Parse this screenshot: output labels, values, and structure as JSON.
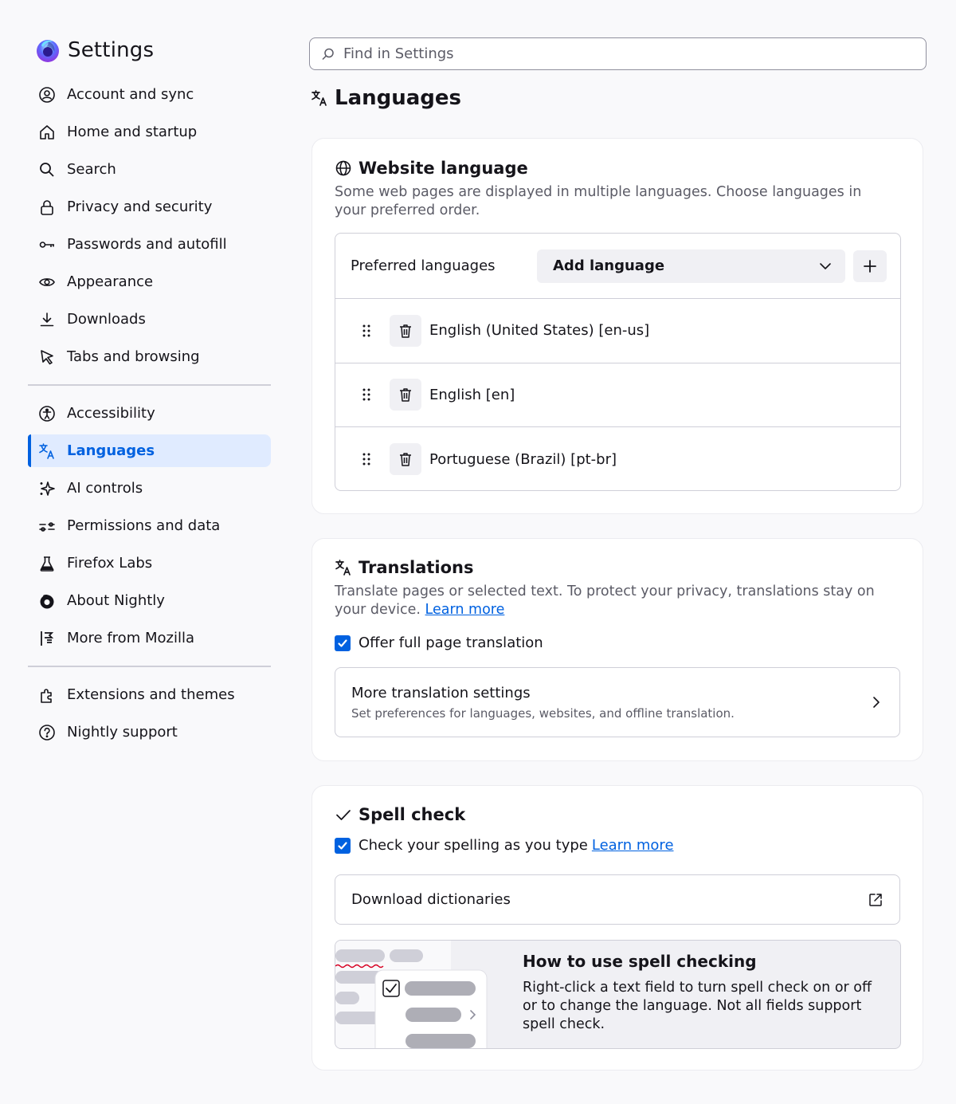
{
  "sidebar": {
    "title": "Settings",
    "groups": [
      [
        {
          "label": "Account and sync",
          "icon": "account-icon"
        },
        {
          "label": "Home and startup",
          "icon": "home-icon"
        },
        {
          "label": "Search",
          "icon": "search-icon"
        },
        {
          "label": "Privacy and security",
          "icon": "lock-icon"
        },
        {
          "label": "Passwords and autofill",
          "icon": "key-icon"
        },
        {
          "label": "Appearance",
          "icon": "eye-icon"
        },
        {
          "label": "Downloads",
          "icon": "download-icon"
        },
        {
          "label": "Tabs and browsing",
          "icon": "cursor-icon"
        }
      ],
      [
        {
          "label": "Accessibility",
          "icon": "accessibility-icon"
        },
        {
          "label": "Languages",
          "icon": "translate-icon",
          "active": true
        },
        {
          "label": "AI controls",
          "icon": "sparkle-icon"
        },
        {
          "label": "Permissions and data",
          "icon": "permissions-icon"
        },
        {
          "label": "Firefox Labs",
          "icon": "flask-icon"
        },
        {
          "label": "About Nightly",
          "icon": "nightly-icon"
        },
        {
          "label": "More from Mozilla",
          "icon": "mozilla-icon"
        }
      ],
      [
        {
          "label": "Extensions and themes",
          "icon": "puzzle-icon"
        },
        {
          "label": "Nightly support",
          "icon": "help-icon"
        }
      ]
    ]
  },
  "search": {
    "placeholder": "Find in Settings"
  },
  "page": {
    "title": "Languages"
  },
  "website_language": {
    "title": "Website language",
    "description": "Some web pages are displayed in multiple languages. Choose languages in your preferred order.",
    "preferred_label": "Preferred languages",
    "add_language": "Add language",
    "languages": [
      "English (United States) [en-us]",
      "English [en]",
      "Portuguese (Brazil) [pt-br]"
    ]
  },
  "translations": {
    "title": "Translations",
    "description": "Translate pages or selected text. To protect your privacy, translations stay on your device.",
    "learn_more": "Learn more",
    "offer_label": "Offer full page translation",
    "offer_checked": true,
    "more_title": "More translation settings",
    "more_sub": "Set preferences for languages, websites, and offline translation."
  },
  "spellcheck": {
    "title": "Spell check",
    "check_label": "Check your spelling as you type",
    "check_checked": true,
    "learn_more": "Learn more",
    "download_label": "Download dictionaries",
    "help_title": "How to use spell checking",
    "help_body": "Right-click a text field to turn spell check on or off or to change the language. Not all fields support spell check."
  },
  "colors": {
    "accent": "#0061e0",
    "active_bg": "#e0ebff",
    "page_bg": "#f9f9fb"
  }
}
